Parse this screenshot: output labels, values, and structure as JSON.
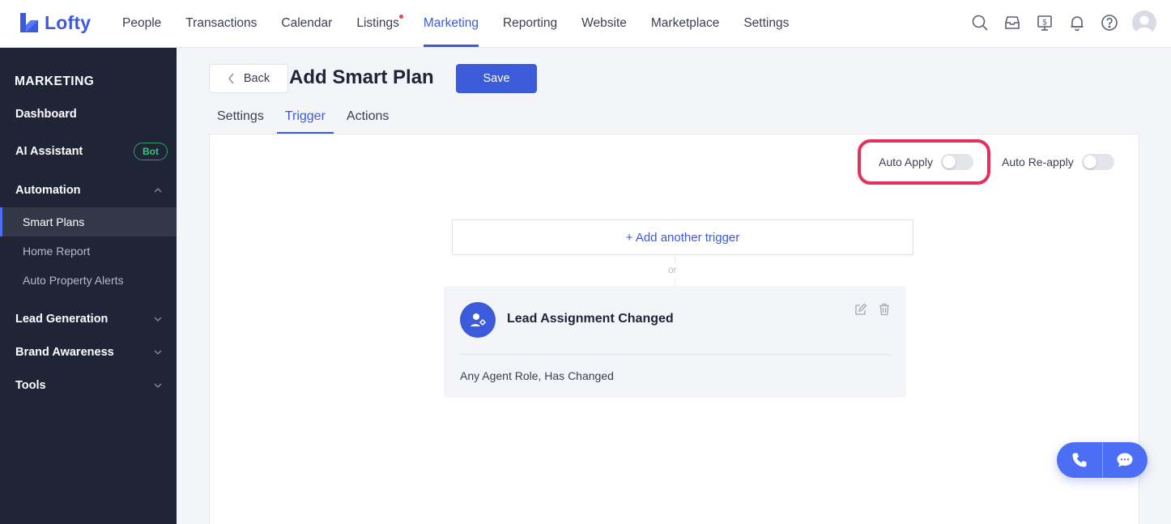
{
  "brand": {
    "name": "Lofty",
    "color": "#3b5bdb"
  },
  "topnav": {
    "items": [
      {
        "label": "People"
      },
      {
        "label": "Transactions"
      },
      {
        "label": "Calendar"
      },
      {
        "label": "Listings"
      },
      {
        "label": "Marketing"
      },
      {
        "label": "Reporting"
      },
      {
        "label": "Website"
      },
      {
        "label": "Marketplace"
      },
      {
        "label": "Settings"
      }
    ],
    "active": "Marketing",
    "notification_dot_on": "Listings",
    "icons": [
      "search-icon",
      "inbox-icon",
      "billing-icon",
      "bell-icon",
      "help-icon",
      "avatar"
    ]
  },
  "sidebar": {
    "title": "MARKETING",
    "dashboard": "Dashboard",
    "ai_assistant": "AI Assistant",
    "bot_badge": "Bot",
    "automation": "Automation",
    "smart_plans": "Smart Plans",
    "home_report": "Home Report",
    "auto_property_alerts": "Auto Property Alerts",
    "lead_generation": "Lead Generation",
    "brand_awareness": "Brand Awareness",
    "tools": "Tools"
  },
  "header": {
    "back_label": "Back",
    "title": "Add Smart Plan",
    "save_label": "Save"
  },
  "tabs": {
    "settings": "Settings",
    "trigger": "Trigger",
    "actions": "Actions",
    "active": "Trigger"
  },
  "panel": {
    "auto_apply_label": "Auto Apply",
    "auto_apply_on": false,
    "auto_reapply_label": "Auto Re-apply",
    "auto_reapply_on": false,
    "add_trigger_label": "+ Add another trigger",
    "or_label": "or",
    "trigger": {
      "title": "Lead Assignment Changed",
      "description": "Any Agent Role, Has Changed"
    }
  },
  "colors": {
    "accent": "#3b5bdb",
    "sidebar_bg": "#202437",
    "highlight_ring": "#e2325c",
    "bot_green": "#38c77e"
  }
}
